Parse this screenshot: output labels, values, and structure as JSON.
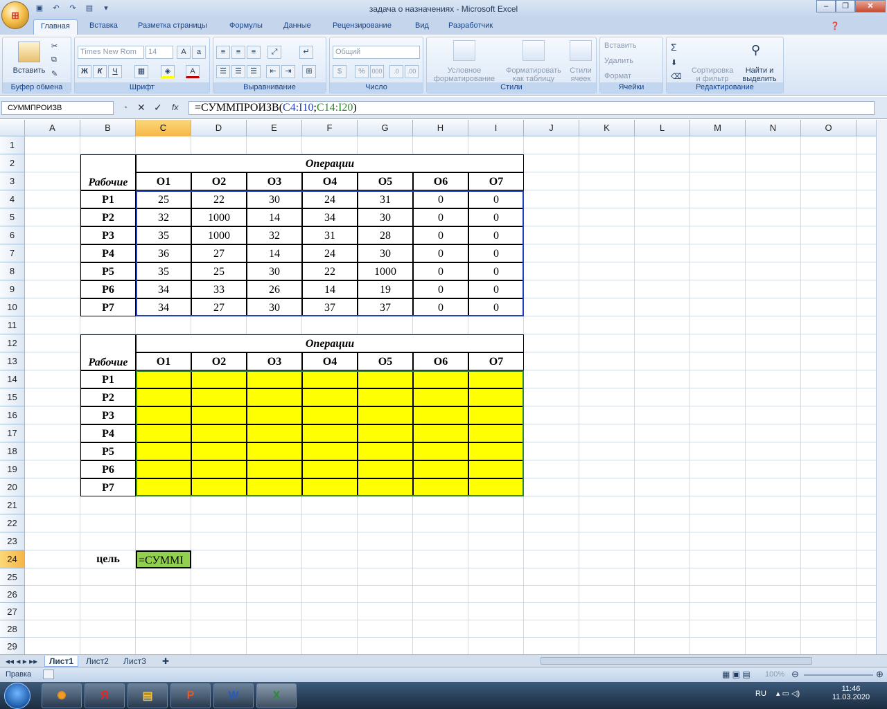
{
  "window": {
    "title": "задача о назначениях - Microsoft Excel"
  },
  "tabs": [
    "Главная",
    "Вставка",
    "Разметка страницы",
    "Формулы",
    "Данные",
    "Рецензирование",
    "Вид",
    "Разработчик"
  ],
  "ribbon": {
    "paste": "Вставить",
    "font_name": "Times New Rom",
    "font_size": "14",
    "number_format": "Общий",
    "groups": [
      "Буфер обмена",
      "Шрифт",
      "Выравнивание",
      "Число",
      "Стили",
      "Ячейки",
      "Редактирование"
    ],
    "cond_format": [
      "Условное",
      "форматирование"
    ],
    "format_table": [
      "Форматировать",
      "как таблицу"
    ],
    "cell_styles": [
      "Стили",
      "ячеек"
    ],
    "insert": "Вставить",
    "delete": "Удалить",
    "format": "Формат",
    "sort": [
      "Сортировка",
      "и фильтр"
    ],
    "find": [
      "Найти и",
      "выделить"
    ],
    "bold": "Ж",
    "italic": "К",
    "underline": "Ч"
  },
  "formula_bar": {
    "name_box": "СУММПРОИЗВ",
    "fx": "fx",
    "formula_prefix": "=СУММПРОИЗВ(",
    "arg1": "C4:I10",
    "sep": ";",
    "arg2": "C14:I20",
    "suffix": ")"
  },
  "columns": [
    "A",
    "B",
    "C",
    "D",
    "E",
    "F",
    "G",
    "H",
    "I",
    "J",
    "K",
    "L",
    "M",
    "N",
    "O"
  ],
  "rows": [
    "1",
    "2",
    "3",
    "4",
    "5",
    "6",
    "7",
    "8",
    "9",
    "10",
    "11",
    "12",
    "13",
    "14",
    "15",
    "16",
    "17",
    "18",
    "19",
    "20",
    "21",
    "22",
    "23",
    "24",
    "25",
    "26",
    "27",
    "28",
    "29"
  ],
  "table1": {
    "header_ops": "Операции",
    "header_workers": "Рабочие",
    "ops": [
      "O1",
      "O2",
      "O3",
      "O4",
      "O5",
      "O6",
      "O7"
    ],
    "workers": [
      "P1",
      "P2",
      "P3",
      "P4",
      "P5",
      "P6",
      "P7"
    ],
    "values": [
      [
        "25",
        "22",
        "30",
        "24",
        "31",
        "0",
        "0"
      ],
      [
        "32",
        "1000",
        "14",
        "34",
        "30",
        "0",
        "0"
      ],
      [
        "35",
        "1000",
        "32",
        "31",
        "28",
        "0",
        "0"
      ],
      [
        "36",
        "27",
        "14",
        "24",
        "30",
        "0",
        "0"
      ],
      [
        "35",
        "25",
        "30",
        "22",
        "1000",
        "0",
        "0"
      ],
      [
        "34",
        "33",
        "26",
        "14",
        "19",
        "0",
        "0"
      ],
      [
        "34",
        "27",
        "30",
        "37",
        "37",
        "0",
        "0"
      ]
    ]
  },
  "table2": {
    "header_ops": "Операции",
    "header_workers": "Рабочие",
    "ops": [
      "O1",
      "O2",
      "O3",
      "O4",
      "O5",
      "O6",
      "O7"
    ],
    "workers": [
      "P1",
      "P2",
      "P3",
      "P4",
      "P5",
      "P6",
      "P7"
    ],
    "fill_color": "#ffff00"
  },
  "goal": {
    "label": "цель",
    "cell_text": "=СУММI",
    "fill_color": "#92d050"
  },
  "sheets": [
    "Лист1",
    "Лист2",
    "Лист3"
  ],
  "status": {
    "mode": "Правка",
    "zoom": "100%"
  },
  "taskbar": {
    "lang": "RU",
    "time": "11:46",
    "date": "11.03.2020"
  }
}
